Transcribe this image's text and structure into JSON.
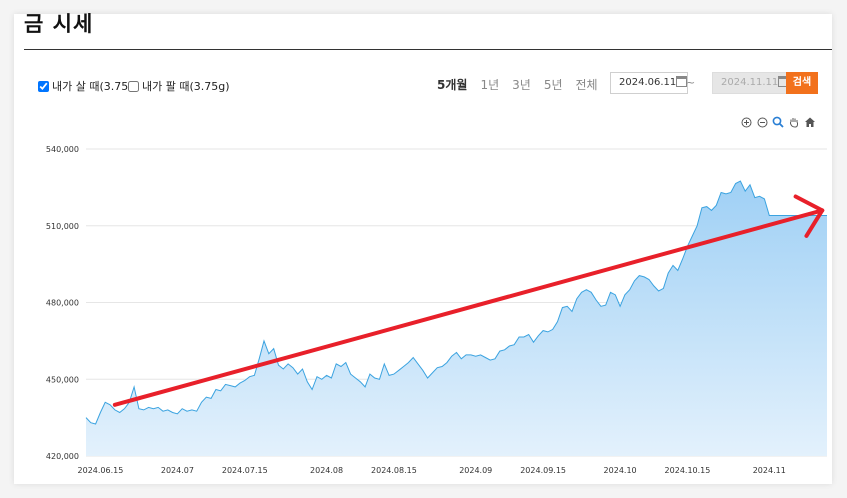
{
  "header": {
    "title": "금 시세"
  },
  "options": {
    "buy_label": "내가 살 때(3.75g)",
    "buy_checked": true,
    "sell_label": "내가 팔 때(3.75g)",
    "sell_checked": false
  },
  "periods": [
    "5개월",
    "1년",
    "3년",
    "5년",
    "전체"
  ],
  "active_period": "5개월",
  "date_range": {
    "start": "2024.06.11",
    "separator": "~",
    "end": "2024.11.11",
    "search_label": "검색"
  },
  "toolbar_icons": [
    "zoom-in-icon",
    "zoom-out-icon",
    "magnify-icon",
    "hand-pan-icon",
    "home-icon"
  ],
  "colors": {
    "line": "#3ba3e0",
    "area_top": "#9fd0f5",
    "area_bottom": "#e3f1fc",
    "arrow": "#e8202a",
    "search_button": "#f2711c"
  },
  "chart_data": {
    "type": "area",
    "x_start": "2024.06.12",
    "x_end": "2024.11.13",
    "ylim": [
      420000,
      540000
    ],
    "y_ticks": [
      {
        "value": 540000,
        "label": "540,000"
      },
      {
        "value": 510000,
        "label": "510,000"
      },
      {
        "value": 480000,
        "label": "480,000"
      },
      {
        "value": 450000,
        "label": "450,000"
      },
      {
        "value": 420000,
        "label": "420,000"
      }
    ],
    "x_ticks": [
      {
        "date": "2024-06-15",
        "label": "2024.06.15"
      },
      {
        "date": "2024-07-01",
        "label": "2024.07"
      },
      {
        "date": "2024-07-15",
        "label": "2024.07.15"
      },
      {
        "date": "2024-08-01",
        "label": "2024.08"
      },
      {
        "date": "2024-08-15",
        "label": "2024.08.15"
      },
      {
        "date": "2024-09-01",
        "label": "2024.09"
      },
      {
        "date": "2024-09-15",
        "label": "2024.09.15"
      },
      {
        "date": "2024-10-01",
        "label": "2024.10"
      },
      {
        "date": "2024-10-15",
        "label": "2024.10.15"
      },
      {
        "date": "2024-11-01",
        "label": "2024.11"
      }
    ],
    "series": [
      {
        "values": [
          [
            "2024-06-12",
            435000
          ],
          [
            "2024-06-13",
            433000
          ],
          [
            "2024-06-14",
            432500
          ],
          [
            "2024-06-15",
            437000
          ],
          [
            "2024-06-16",
            441000
          ],
          [
            "2024-06-17",
            440000
          ],
          [
            "2024-06-18",
            438000
          ],
          [
            "2024-06-19",
            437000
          ],
          [
            "2024-06-20",
            438500
          ],
          [
            "2024-06-21",
            441000
          ],
          [
            "2024-06-22",
            447000
          ],
          [
            "2024-06-23",
            438500
          ],
          [
            "2024-06-24",
            438000
          ],
          [
            "2024-06-25",
            439000
          ],
          [
            "2024-06-26",
            438500
          ],
          [
            "2024-06-27",
            439000
          ],
          [
            "2024-06-28",
            437500
          ],
          [
            "2024-06-29",
            438000
          ],
          [
            "2024-06-30",
            437000
          ],
          [
            "2024-07-01",
            436500
          ],
          [
            "2024-07-02",
            438500
          ],
          [
            "2024-07-03",
            437500
          ],
          [
            "2024-07-04",
            438000
          ],
          [
            "2024-07-05",
            437500
          ],
          [
            "2024-07-06",
            441000
          ],
          [
            "2024-07-07",
            443000
          ],
          [
            "2024-07-08",
            442500
          ],
          [
            "2024-07-09",
            446000
          ],
          [
            "2024-07-10",
            445500
          ],
          [
            "2024-07-11",
            448000
          ],
          [
            "2024-07-12",
            447500
          ],
          [
            "2024-07-13",
            447000
          ],
          [
            "2024-07-14",
            448500
          ],
          [
            "2024-07-15",
            449500
          ],
          [
            "2024-07-16",
            451000
          ],
          [
            "2024-07-17",
            451500
          ],
          [
            "2024-07-18",
            458000
          ],
          [
            "2024-07-19",
            465000
          ],
          [
            "2024-07-20",
            460000
          ],
          [
            "2024-07-21",
            462000
          ],
          [
            "2024-07-22",
            455500
          ],
          [
            "2024-07-23",
            454000
          ],
          [
            "2024-07-24",
            456000
          ],
          [
            "2024-07-25",
            454500
          ],
          [
            "2024-07-26",
            452000
          ],
          [
            "2024-07-27",
            454000
          ],
          [
            "2024-07-28",
            449000
          ],
          [
            "2024-07-29",
            446000
          ],
          [
            "2024-07-30",
            451000
          ],
          [
            "2024-07-31",
            450000
          ],
          [
            "2024-08-01",
            451500
          ],
          [
            "2024-08-02",
            450500
          ],
          [
            "2024-08-03",
            456000
          ],
          [
            "2024-08-04",
            455000
          ],
          [
            "2024-08-05",
            456500
          ],
          [
            "2024-08-06",
            452000
          ],
          [
            "2024-08-07",
            450500
          ],
          [
            "2024-08-08",
            449000
          ],
          [
            "2024-08-09",
            447000
          ],
          [
            "2024-08-10",
            452000
          ],
          [
            "2024-08-11",
            450500
          ],
          [
            "2024-08-12",
            450000
          ],
          [
            "2024-08-13",
            456000
          ],
          [
            "2024-08-14",
            451500
          ],
          [
            "2024-08-15",
            452000
          ],
          [
            "2024-08-16",
            453500
          ],
          [
            "2024-08-17",
            455000
          ],
          [
            "2024-08-18",
            456500
          ],
          [
            "2024-08-19",
            458500
          ],
          [
            "2024-08-20",
            456000
          ],
          [
            "2024-08-21",
            453500
          ],
          [
            "2024-08-22",
            450500
          ],
          [
            "2024-08-23",
            452500
          ],
          [
            "2024-08-24",
            454500
          ],
          [
            "2024-08-25",
            455000
          ],
          [
            "2024-08-26",
            456500
          ],
          [
            "2024-08-27",
            459000
          ],
          [
            "2024-08-28",
            460500
          ],
          [
            "2024-08-29",
            458000
          ],
          [
            "2024-08-30",
            459500
          ],
          [
            "2024-08-31",
            459500
          ],
          [
            "2024-09-01",
            459000
          ],
          [
            "2024-09-02",
            459500
          ],
          [
            "2024-09-03",
            458500
          ],
          [
            "2024-09-04",
            457500
          ],
          [
            "2024-09-05",
            458000
          ],
          [
            "2024-09-06",
            461000
          ],
          [
            "2024-09-07",
            461500
          ],
          [
            "2024-09-08",
            463000
          ],
          [
            "2024-09-09",
            463500
          ],
          [
            "2024-09-10",
            466500
          ],
          [
            "2024-09-11",
            466500
          ],
          [
            "2024-09-12",
            467500
          ],
          [
            "2024-09-13",
            464500
          ],
          [
            "2024-09-14",
            467000
          ],
          [
            "2024-09-15",
            469000
          ],
          [
            "2024-09-16",
            468500
          ],
          [
            "2024-09-17",
            469500
          ],
          [
            "2024-09-18",
            472500
          ],
          [
            "2024-09-19",
            478000
          ],
          [
            "2024-09-20",
            478500
          ],
          [
            "2024-09-21",
            476500
          ],
          [
            "2024-09-22",
            481500
          ],
          [
            "2024-09-23",
            484000
          ],
          [
            "2024-09-24",
            485000
          ],
          [
            "2024-09-25",
            484000
          ],
          [
            "2024-09-26",
            481000
          ],
          [
            "2024-09-27",
            478500
          ],
          [
            "2024-09-28",
            479000
          ],
          [
            "2024-09-29",
            484000
          ],
          [
            "2024-09-30",
            483000
          ],
          [
            "2024-10-01",
            478500
          ],
          [
            "2024-10-02",
            483000
          ],
          [
            "2024-10-03",
            485000
          ],
          [
            "2024-10-04",
            488500
          ],
          [
            "2024-10-05",
            490500
          ],
          [
            "2024-10-06",
            490000
          ],
          [
            "2024-10-07",
            489000
          ],
          [
            "2024-10-08",
            486500
          ],
          [
            "2024-10-09",
            484500
          ],
          [
            "2024-10-10",
            485500
          ],
          [
            "2024-10-11",
            491500
          ],
          [
            "2024-10-12",
            494500
          ],
          [
            "2024-10-13",
            492500
          ],
          [
            "2024-10-14",
            497000
          ],
          [
            "2024-10-15",
            502000
          ],
          [
            "2024-10-16",
            506000
          ],
          [
            "2024-10-17",
            510000
          ],
          [
            "2024-10-18",
            517000
          ],
          [
            "2024-10-19",
            517500
          ],
          [
            "2024-10-20",
            516000
          ],
          [
            "2024-10-21",
            518000
          ],
          [
            "2024-10-22",
            523000
          ],
          [
            "2024-10-23",
            522500
          ],
          [
            "2024-10-24",
            523000
          ],
          [
            "2024-10-25",
            526500
          ],
          [
            "2024-10-26",
            527500
          ],
          [
            "2024-10-27",
            523500
          ],
          [
            "2024-10-28",
            526000
          ],
          [
            "2024-10-29",
            521000
          ],
          [
            "2024-10-30",
            521500
          ],
          [
            "2024-10-31",
            520500
          ],
          [
            "2024-11-01",
            514000
          ],
          [
            "2024-11-02",
            514000
          ],
          [
            "2024-11-03",
            514000
          ],
          [
            "2024-11-04",
            514000
          ],
          [
            "2024-11-05",
            514000
          ],
          [
            "2024-11-06",
            514000
          ],
          [
            "2024-11-07",
            514000
          ],
          [
            "2024-11-08",
            514000
          ],
          [
            "2024-11-09",
            514000
          ],
          [
            "2024-11-10",
            514000
          ],
          [
            "2024-11-11",
            514000
          ],
          [
            "2024-11-12",
            514000
          ],
          [
            "2024-11-13",
            514000
          ]
        ]
      }
    ],
    "annotation": {
      "type": "trend-arrow",
      "from": [
        "2024-06-18",
        440000
      ],
      "to": [
        "2024-11-12",
        516000
      ]
    },
    "grid": true
  }
}
